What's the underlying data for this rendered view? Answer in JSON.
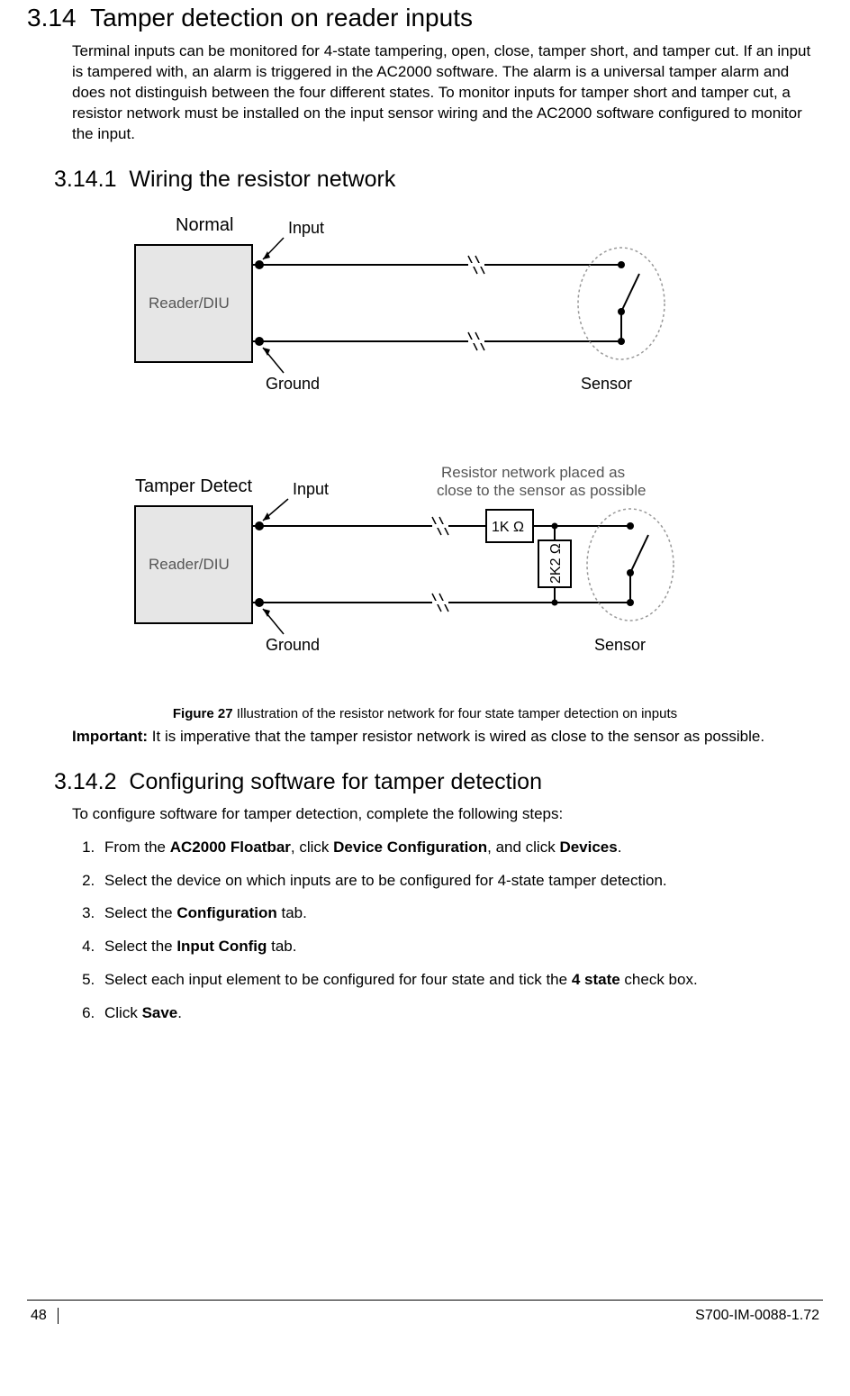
{
  "section": {
    "number": "3.14",
    "title": "Tamper detection on reader inputs",
    "intro": "Terminal inputs can be monitored for 4-state tampering, open, close, tamper short, and tamper cut. If an input is tampered with, an alarm is triggered in the AC2000 software. The alarm is a universal tamper alarm and does not distinguish between the four different states. To monitor inputs for tamper short and tamper cut, a resistor network must be installed on the input sensor wiring and the AC2000 software configured to monitor the input."
  },
  "sub1": {
    "number": "3.14.1",
    "title": "Wiring the resistor network"
  },
  "diagram": {
    "normal": {
      "title": "Normal",
      "box": "Reader/DIU",
      "input": "Input",
      "ground": "Ground",
      "sensor": "Sensor"
    },
    "tamper": {
      "title": "Tamper Detect",
      "box": "Reader/DIU",
      "input": "Input",
      "ground": "Ground",
      "sensor": "Sensor",
      "note": "Resistor network placed as close to the sensor as possible",
      "r1": "1K Ω",
      "r2": "2K2 Ω"
    }
  },
  "figure": {
    "label": "Figure 27",
    "caption": "Illustration of the resistor network for four state tamper detection on inputs"
  },
  "important": {
    "label": "Important:",
    "text": "It is imperative that the tamper resistor network is wired as close to the sensor as possible."
  },
  "sub2": {
    "number": "3.14.2",
    "title": "Configuring software for tamper detection",
    "intro": "To configure software for tamper detection, complete the following steps:",
    "steps": [
      {
        "pre": "From the ",
        "b1": "AC2000 Floatbar",
        "mid1": ", click ",
        "b2": "Device Configuration",
        "mid2": ", and click ",
        "b3": "Devices",
        "post": "."
      },
      {
        "text": "Select the device on which inputs are to be configured for 4-state tamper detection."
      },
      {
        "pre": "Select the ",
        "b1": "Configuration",
        "post": " tab."
      },
      {
        "pre": "Select the ",
        "b1": "Input Config",
        "post": " tab."
      },
      {
        "pre": "Select each input element to be configured for four state and tick the ",
        "b1": "4 state",
        "post": " check box."
      },
      {
        "pre": "Click ",
        "b1": "Save",
        "post": "."
      }
    ]
  },
  "footer": {
    "page": "48",
    "doc": "S700-IM-0088-1.72"
  }
}
